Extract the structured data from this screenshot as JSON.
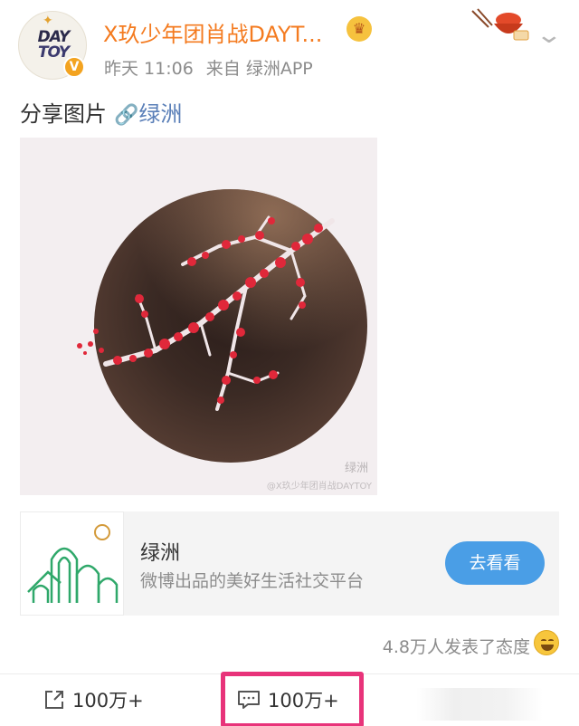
{
  "post": {
    "author": {
      "name": "X玖少年团肖战DAYT...",
      "avatar_text_line1": "DAY",
      "avatar_text_line2": "TOY",
      "verified_badge": "V"
    },
    "meta": {
      "time": "昨天 11:06",
      "source": "来自 绿洲APP"
    },
    "text": {
      "body": "分享图片",
      "link_label": "绿洲"
    },
    "image": {
      "watermark_main": "绿洲",
      "watermark_sub": "@X玖少年团肖战DAYTOY"
    },
    "app_card": {
      "title": "绿洲",
      "description": "微博出品的美好生活社交平台",
      "button_label": "去看看"
    },
    "reactions": {
      "summary": "4.8万人发表了态度"
    },
    "actions": {
      "share_count": "100万+",
      "comment_count": "100万+"
    }
  },
  "colors": {
    "username": "#f47b20",
    "link": "#5a7fb8",
    "button": "#4a9ee6",
    "highlight": "#e8337a",
    "meta": "#8c8c8c"
  },
  "icons": {
    "link": "link-icon",
    "share": "share-icon",
    "comment": "comment-icon",
    "dropdown": "chevron-down-icon",
    "vip": "crown-icon",
    "emoji": "smile-emoji-icon"
  }
}
